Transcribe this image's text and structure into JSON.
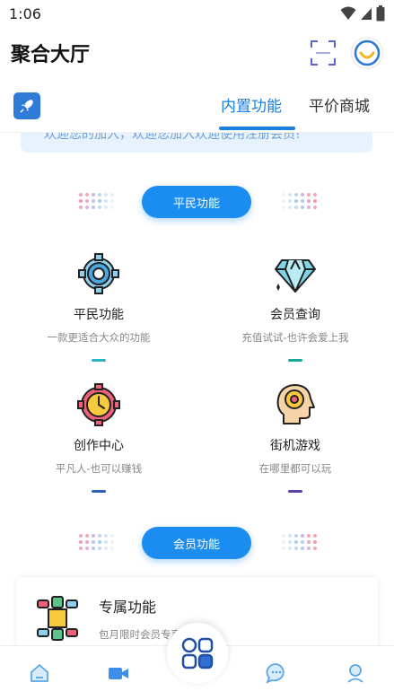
{
  "status_bar": {
    "time": "1:06"
  },
  "header": {
    "title": "聚合大厅"
  },
  "tabs": [
    {
      "label": "内置功能",
      "active": true
    },
    {
      "label": "平价商城",
      "active": false
    }
  ],
  "notice": {
    "text": "欢迎您的加入，欢迎您加入欢迎使用注册会员!"
  },
  "sections": {
    "basic": {
      "label": "平民功能"
    },
    "vip": {
      "label": "会员功能"
    }
  },
  "features": [
    {
      "title": "平民功能",
      "desc": "一款更适合大众的功能",
      "icon": "gear-icon",
      "accent": "#2bb5c4"
    },
    {
      "title": "会员查询",
      "desc": "充值试试-也许会爱上我",
      "icon": "diamond-icon",
      "accent": "#18a89a"
    },
    {
      "title": "创作中心",
      "desc": "平凡人-也可以赚钱",
      "icon": "clock-gear-icon",
      "accent": "#2f5fb3"
    },
    {
      "title": "街机游戏",
      "desc": "在哪里都可以玩",
      "icon": "brain-gear-icon",
      "accent": "#5b3fa0"
    }
  ],
  "vip_card": {
    "title": "专属功能",
    "desc": "包月限时会员专享",
    "icon": "hands-teamwork-icon"
  },
  "bottom_nav": [
    {
      "name": "home-icon"
    },
    {
      "name": "video-icon"
    },
    {
      "name": "apps-icon"
    },
    {
      "name": "chat-icon"
    },
    {
      "name": "profile-icon"
    }
  ],
  "colors": {
    "accent": "#1b8cf0",
    "primary_text": "#222222",
    "secondary_text": "#888888"
  }
}
